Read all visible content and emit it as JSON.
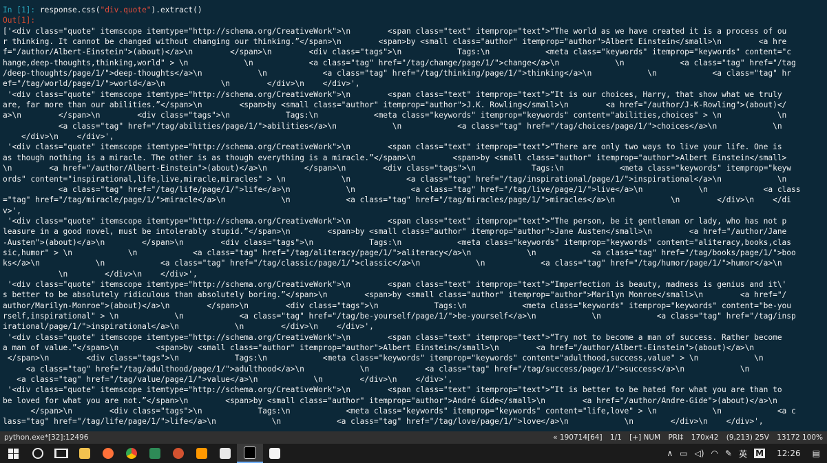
{
  "console": {
    "in_prompt": "In [1]:",
    "command_pre": " response.css(",
    "command_string": "\"div.quote\"",
    "command_post": ").extract()",
    "out_prompt": "Out[1]:",
    "output_lines": [
      "['<div class=\"quote\" itemscope itemtype=\"http://schema.org/CreativeWork\">\\n        <span class=\"text\" itemprop=\"text\">“The world as we have created it is a process of ou",
      "r thinking. It cannot be changed without changing our thinking.”</span>\\n        <span>by <small class=\"author\" itemprop=\"author\">Albert Einstein</small>\\n        <a hre",
      "f=\"/author/Albert-Einstein\">(about)</a>\\n        </span>\\n        <div class=\"tags\">\\n            Tags:\\n            <meta class=\"keywords\" itemprop=\"keywords\" content=\"c",
      "hange,deep-thoughts,thinking,world\" > \\n            \\n            <a class=\"tag\" href=\"/tag/change/page/1/\">change</a>\\n            \\n            <a class=\"tag\" href=\"/tag",
      "/deep-thoughts/page/1/\">deep-thoughts</a>\\n            \\n            <a class=\"tag\" href=\"/tag/thinking/page/1/\">thinking</a>\\n            \\n            <a class=\"tag\" hr",
      "ef=\"/tag/world/page/1/\">world</a>\\n            \\n        </div>\\n    </div>',",
      " '<div class=\"quote\" itemscope itemtype=\"http://schema.org/CreativeWork\">\\n        <span class=\"text\" itemprop=\"text\">“It is our choices, Harry, that show what we truly",
      "are, far more than our abilities.”</span>\\n        <span>by <small class=\"author\" itemprop=\"author\">J.K. Rowling</small>\\n        <a href=\"/author/J-K-Rowling\">(about)</",
      "a>\\n        </span>\\n        <div class=\"tags\">\\n            Tags:\\n            <meta class=\"keywords\" itemprop=\"keywords\" content=\"abilities,choices\" > \\n            \\n",
      "            <a class=\"tag\" href=\"/tag/abilities/page/1/\">abilities</a>\\n            \\n            <a class=\"tag\" href=\"/tag/choices/page/1/\">choices</a>\\n            \\n",
      "    </div>\\n    </div>',",
      " '<div class=\"quote\" itemscope itemtype=\"http://schema.org/CreativeWork\">\\n        <span class=\"text\" itemprop=\"text\">“There are only two ways to live your life. One is",
      "as though nothing is a miracle. The other is as though everything is a miracle.”</span>\\n        <span>by <small class=\"author\" itemprop=\"author\">Albert Einstein</small>",
      "\\n        <a href=\"/author/Albert-Einstein\">(about)</a>\\n        </span>\\n        <div class=\"tags\">\\n            Tags:\\n            <meta class=\"keywords\" itemprop=\"keyw",
      "ords\" content=\"inspirational,life,live,miracle,miracles\" > \\n            \\n            <a class=\"tag\" href=\"/tag/inspirational/page/1/\">inspirational</a>\\n            \\n",
      "            <a class=\"tag\" href=\"/tag/life/page/1/\">life</a>\\n            \\n            <a class=\"tag\" href=\"/tag/live/page/1/\">live</a>\\n            \\n            <a class",
      "=\"tag\" href=\"/tag/miracle/page/1/\">miracle</a>\\n            \\n            <a class=\"tag\" href=\"/tag/miracles/page/1/\">miracles</a>\\n            \\n        </div>\\n    </di",
      "v>',",
      " '<div class=\"quote\" itemscope itemtype=\"http://schema.org/CreativeWork\">\\n        <span class=\"text\" itemprop=\"text\">“The person, be it gentleman or lady, who has not p",
      "leasure in a good novel, must be intolerably stupid.”</span>\\n        <span>by <small class=\"author\" itemprop=\"author\">Jane Austen</small>\\n        <a href=\"/author/Jane",
      "-Austen\">(about)</a>\\n        </span>\\n        <div class=\"tags\">\\n            Tags:\\n            <meta class=\"keywords\" itemprop=\"keywords\" content=\"aliteracy,books,clas",
      "sic,humor\" > \\n            \\n            <a class=\"tag\" href=\"/tag/aliteracy/page/1/\">aliteracy</a>\\n            \\n            <a class=\"tag\" href=\"/tag/books/page/1/\">boo",
      "ks</a>\\n            \\n            <a class=\"tag\" href=\"/tag/classic/page/1/\">classic</a>\\n            \\n            <a class=\"tag\" href=\"/tag/humor/page/1/\">humor</a>\\n",
      "            \\n        </div>\\n    </div>',",
      " '<div class=\"quote\" itemscope itemtype=\"http://schema.org/CreativeWork\">\\n        <span class=\"text\" itemprop=\"text\">“Imperfection is beauty, madness is genius and it\\'",
      "s better to be absolutely ridiculous than absolutely boring.”</span>\\n        <span>by <small class=\"author\" itemprop=\"author\">Marilyn Monroe</small>\\n        <a href=\"/",
      "author/Marilyn-Monroe\">(about)</a>\\n        </span>\\n        <div class=\"tags\">\\n            Tags:\\n            <meta class=\"keywords\" itemprop=\"keywords\" content=\"be-you",
      "rself,inspirational\" > \\n            \\n            <a class=\"tag\" href=\"/tag/be-yourself/page/1/\">be-yourself</a>\\n            \\n            <a class=\"tag\" href=\"/tag/insp",
      "irational/page/1/\">inspirational</a>\\n            \\n        </div>\\n    </div>',",
      " '<div class=\"quote\" itemscope itemtype=\"http://schema.org/CreativeWork\">\\n        <span class=\"text\" itemprop=\"text\">“Try not to become a man of success. Rather become",
      "a man of value.”</span>\\n        <span>by <small class=\"author\" itemprop=\"author\">Albert Einstein</small>\\n        <a href=\"/author/Albert-Einstein\">(about)</a>\\n",
      " </span>\\n        <div class=\"tags\">\\n            Tags:\\n            <meta class=\"keywords\" itemprop=\"keywords\" content=\"adulthood,success,value\" > \\n            \\n",
      "     <a class=\"tag\" href=\"/tag/adulthood/page/1/\">adulthood</a>\\n            \\n            <a class=\"tag\" href=\"/tag/success/page/1/\">success</a>\\n            \\n",
      "   <a class=\"tag\" href=\"/tag/value/page/1/\">value</a>\\n            \\n        </div>\\n    </div>',",
      " '<div class=\"quote\" itemscope itemtype=\"http://schema.org/CreativeWork\">\\n        <span class=\"text\" itemprop=\"text\">“It is better to be hated for what you are than to",
      "be loved for what you are not.”</span>\\n        <span>by <small class=\"author\" itemprop=\"author\">André Gide</small>\\n        <a href=\"/author/Andre-Gide\">(about)</a>\\n",
      "      </span>\\n        <div class=\"tags\">\\n            Tags:\\n            <meta class=\"keywords\" itemprop=\"keywords\" content=\"life,love\" > \\n            \\n            <a c",
      "lass=\"tag\" href=\"/tag/life/page/1/\">life</a>\\n            \\n            <a class=\"tag\" href=\"/tag/love/page/1/\">love</a>\\n            \\n        </div>\\n    </div>',"
    ]
  },
  "status_bar": {
    "process": "python.exe*[32]:12496",
    "build": "« 190714[64]",
    "pane": "1/1",
    "mode": "[+] NUM",
    "priority": "PRI‡",
    "size": "170x42",
    "cursor": "(9,213) 25V",
    "memory": "13172 100%"
  },
  "taskbar": {
    "ime_lang": "英",
    "ime_mode": "M",
    "clock": "12:26",
    "tray_icons": [
      "chevron-up-icon",
      "battery-icon",
      "volume-icon",
      "wifi-icon",
      "pen-icon"
    ],
    "app_colors": {
      "file_explorer": "#f2c24f",
      "firefox": "#ff7139",
      "chrome": "#4285f4",
      "terminal_green": "#2e8b57",
      "powerpoint": "#d35230",
      "sublime": "#ff9800",
      "video": "#e8e8e8",
      "console_active": "#000000",
      "notepad": "#f5f5f5"
    }
  }
}
